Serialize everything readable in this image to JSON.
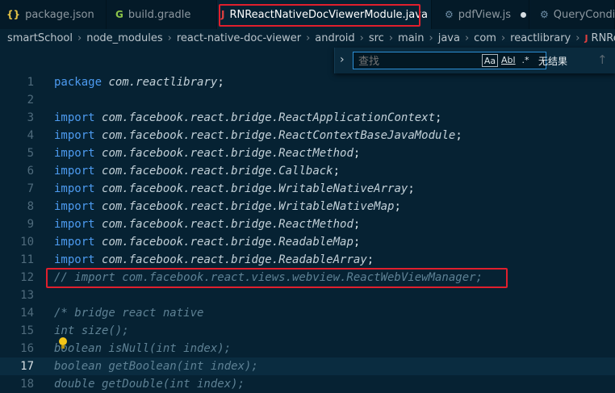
{
  "tabs": [
    {
      "icon": "json-braces-icon",
      "glyph": "{}",
      "label": "package.json",
      "active": false
    },
    {
      "icon": "gradle-icon",
      "glyph": "G",
      "label": "build.gradle",
      "active": false
    },
    {
      "icon": "java-error-icon",
      "glyph": "J",
      "label": "RNReactNativeDocViewerModule.java",
      "active": true,
      "close": "×"
    },
    {
      "icon": "js-gear-icon",
      "glyph": "⚙",
      "label": "pdfView.js",
      "active": false,
      "modified": true
    },
    {
      "icon": "gear-icon",
      "glyph": "⚙",
      "label": "QueryConditi",
      "active": false
    }
  ],
  "breadcrumb": [
    "smartSchool",
    "node_modules",
    "react-native-doc-viewer",
    "android",
    "src",
    "main",
    "java",
    "com",
    "reactlibrary",
    "RNReactNativeDocV"
  ],
  "find": {
    "placeholder": "查找",
    "match_case": "Aa",
    "whole_word": "Abl",
    "regex": ".*",
    "result": "无结果",
    "prev": "↑",
    "toggle": "›"
  },
  "editor": {
    "current_line": 17,
    "lines": [
      {
        "n": "1",
        "kind": "package",
        "kw": "package",
        "rest": "com.reactlibrary",
        "end": ";"
      },
      {
        "n": "2",
        "kind": "blank"
      },
      {
        "n": "3",
        "kind": "import",
        "kw": "import",
        "pkg": "com.facebook.react.bridge.",
        "cls": "ReactApplicationContext",
        "end": ";"
      },
      {
        "n": "4",
        "kind": "import",
        "kw": "import",
        "pkg": "com.facebook.react.bridge.",
        "cls": "ReactContextBaseJavaModule",
        "end": ";"
      },
      {
        "n": "5",
        "kind": "import",
        "kw": "import",
        "pkg": "com.facebook.react.bridge.",
        "cls": "ReactMethod",
        "end": ";"
      },
      {
        "n": "6",
        "kind": "import",
        "kw": "import",
        "pkg": "com.facebook.react.bridge.",
        "cls": "Callback",
        "end": ";"
      },
      {
        "n": "7",
        "kind": "import",
        "kw": "import",
        "pkg": "com.facebook.react.bridge.",
        "cls": "WritableNativeArray",
        "end": ";"
      },
      {
        "n": "8",
        "kind": "import",
        "kw": "import",
        "pkg": "com.facebook.react.bridge.",
        "cls": "WritableNativeMap",
        "end": ";"
      },
      {
        "n": "9",
        "kind": "import",
        "kw": "import",
        "pkg": "com.facebook.react.bridge.",
        "cls": "ReactMethod",
        "end": ";"
      },
      {
        "n": "10",
        "kind": "import",
        "kw": "import",
        "pkg": "com.facebook.react.bridge.",
        "cls": "ReadableMap",
        "end": ";"
      },
      {
        "n": "11",
        "kind": "import",
        "kw": "import",
        "pkg": "com.facebook.react.bridge.",
        "cls": "ReadableArray",
        "end": ";"
      },
      {
        "n": "12",
        "kind": "comment",
        "text": "// import com.facebook.react.views.webview.ReactWebViewManager;"
      },
      {
        "n": "13",
        "kind": "blank"
      },
      {
        "n": "14",
        "kind": "comment",
        "text": "/* bridge react native"
      },
      {
        "n": "15",
        "kind": "comment",
        "text": "int size();"
      },
      {
        "n": "16",
        "kind": "comment",
        "text": "boolean isNull(int index);"
      },
      {
        "n": "17",
        "kind": "comment",
        "text": "boolean getBoolean(int index);"
      },
      {
        "n": "18",
        "kind": "comment",
        "text": "double getDouble(int index);"
      }
    ]
  },
  "colors": {
    "background": "#062233",
    "keyword": "#4d9bf0",
    "comment": "#5e8194",
    "highlight_box": "#e01f2d"
  }
}
